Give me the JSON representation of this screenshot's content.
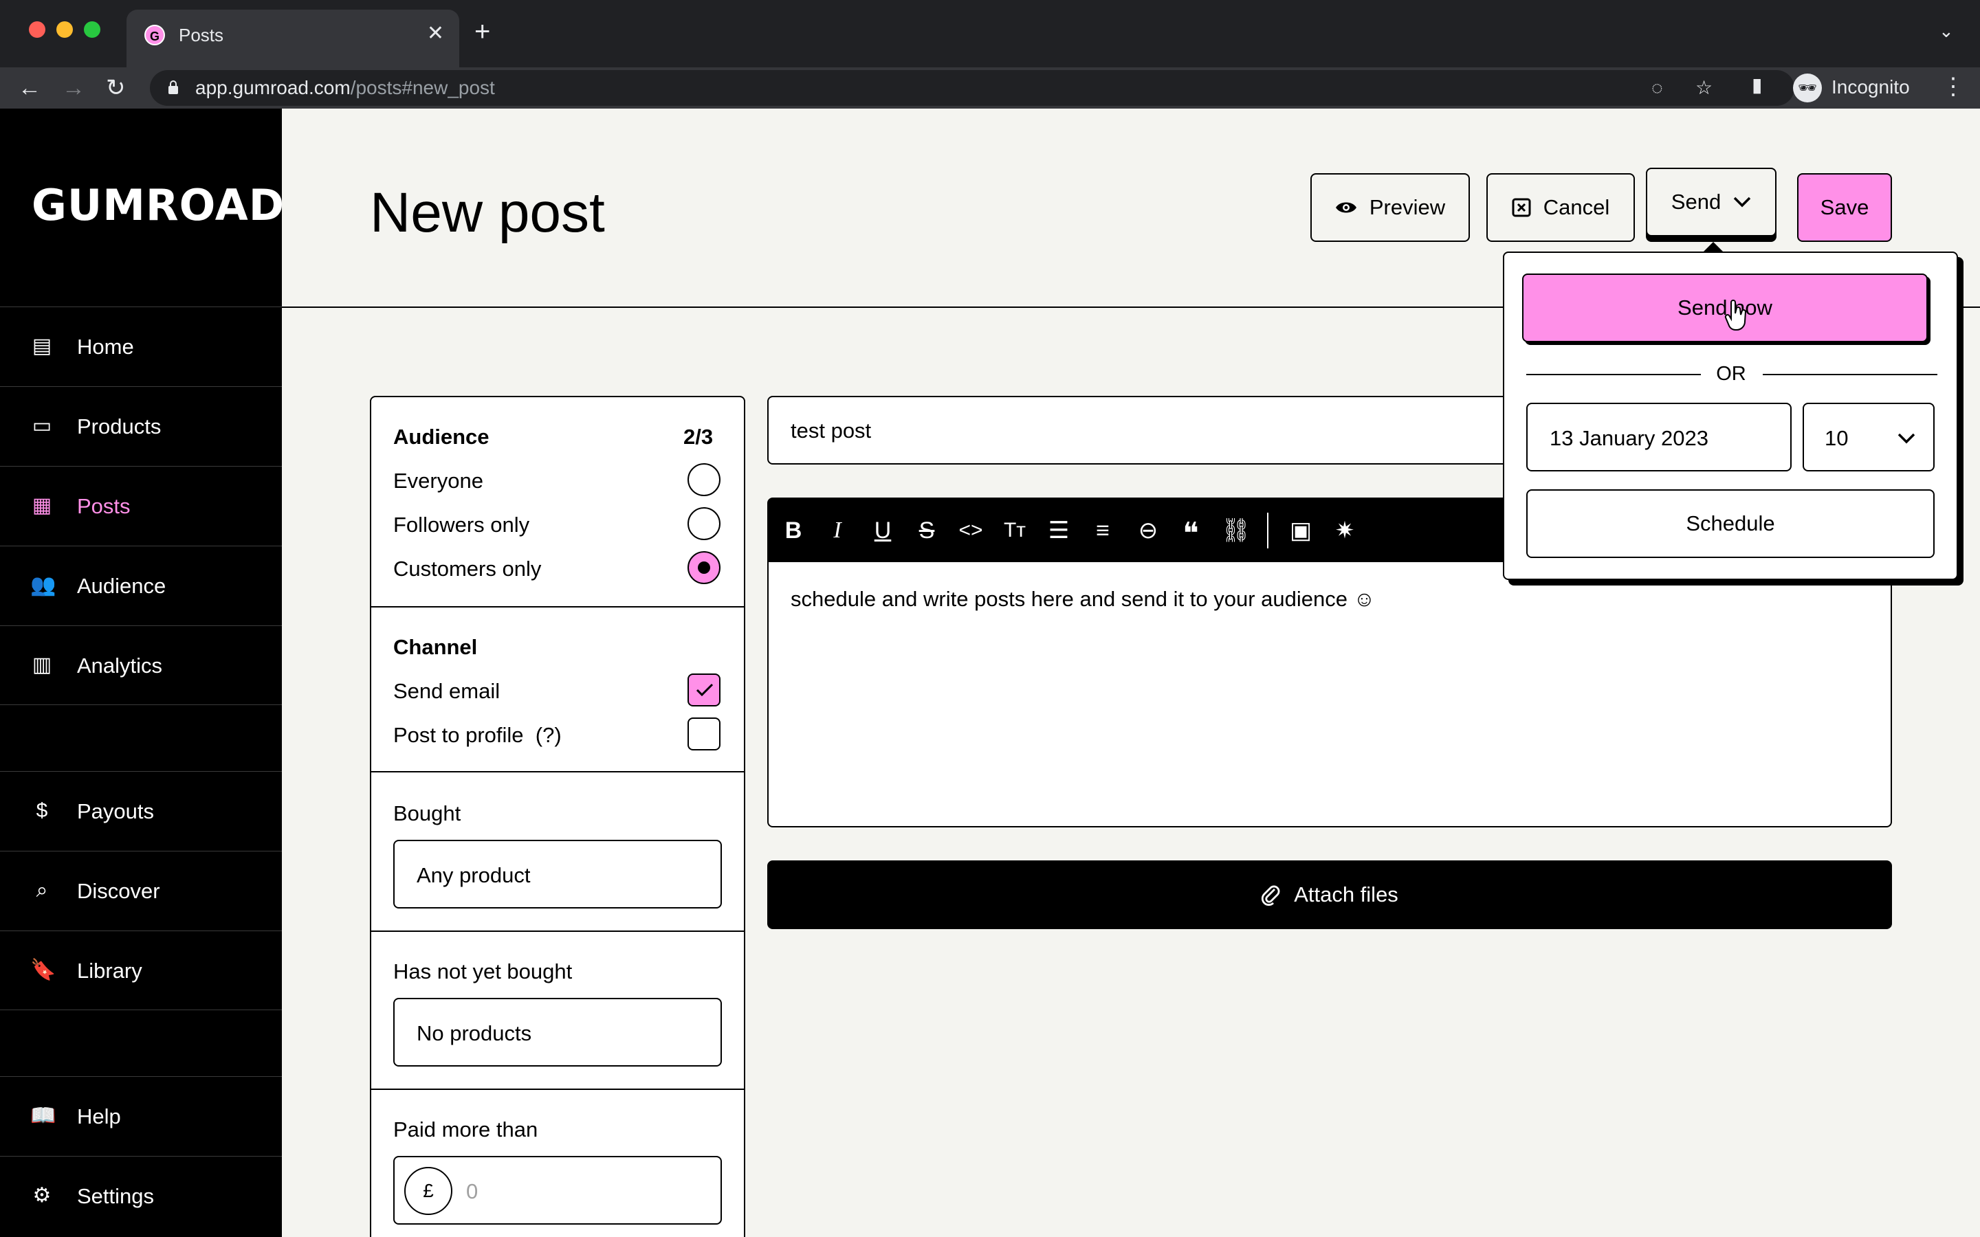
{
  "browser": {
    "tab_title": "Posts",
    "tab_favicon": "G",
    "url_host": "app.gumroad.com",
    "url_path": "/posts#new_post",
    "profile_label": "Incognito"
  },
  "sidebar": {
    "logo": "GUMROAD",
    "items": [
      {
        "label": "Home",
        "icon": "store-icon"
      },
      {
        "label": "Products",
        "icon": "archive-icon"
      },
      {
        "label": "Posts",
        "icon": "document-icon",
        "active": true
      },
      {
        "label": "Audience",
        "icon": "people-icon"
      },
      {
        "label": "Analytics",
        "icon": "bar-chart-icon"
      },
      {
        "label": "Payouts",
        "icon": "dollar-icon"
      },
      {
        "label": "Discover",
        "icon": "search-icon"
      },
      {
        "label": "Library",
        "icon": "bookmark-icon"
      },
      {
        "label": "Help",
        "icon": "book-icon"
      },
      {
        "label": "Settings",
        "icon": "gear-icon"
      }
    ]
  },
  "header": {
    "title": "New post",
    "preview_label": "Preview",
    "cancel_label": "Cancel",
    "send_label": "Send",
    "save_label": "Save"
  },
  "filters": {
    "audience": {
      "heading": "Audience",
      "count": "2/3",
      "options": [
        {
          "label": "Everyone",
          "selected": false
        },
        {
          "label": "Followers only",
          "selected": false
        },
        {
          "label": "Customers only",
          "selected": true
        }
      ]
    },
    "channel": {
      "heading": "Channel",
      "send_email": "Send email",
      "send_email_checked": true,
      "post_to_profile": "Post to profile",
      "help_glyph": "(?)",
      "post_to_profile_checked": false
    },
    "bought": {
      "label": "Bought",
      "value": "Any product"
    },
    "not_bought": {
      "label": "Has not yet bought",
      "value": "No products"
    },
    "paid_more": {
      "label": "Paid more than",
      "currency": "£",
      "placeholder": "0"
    }
  },
  "editor": {
    "title_value": "test post",
    "body": "schedule and write posts here and send it to your audience ☺",
    "attach_label": "Attach files"
  },
  "send_menu": {
    "send_now_label": "Send now",
    "or_label": "OR",
    "date_value": "13 January 2023",
    "hour_value": "10",
    "schedule_label": "Schedule"
  },
  "colors": {
    "accent": "#ff90e8",
    "background": "#f4f4f0",
    "sidebar": "#000000"
  }
}
